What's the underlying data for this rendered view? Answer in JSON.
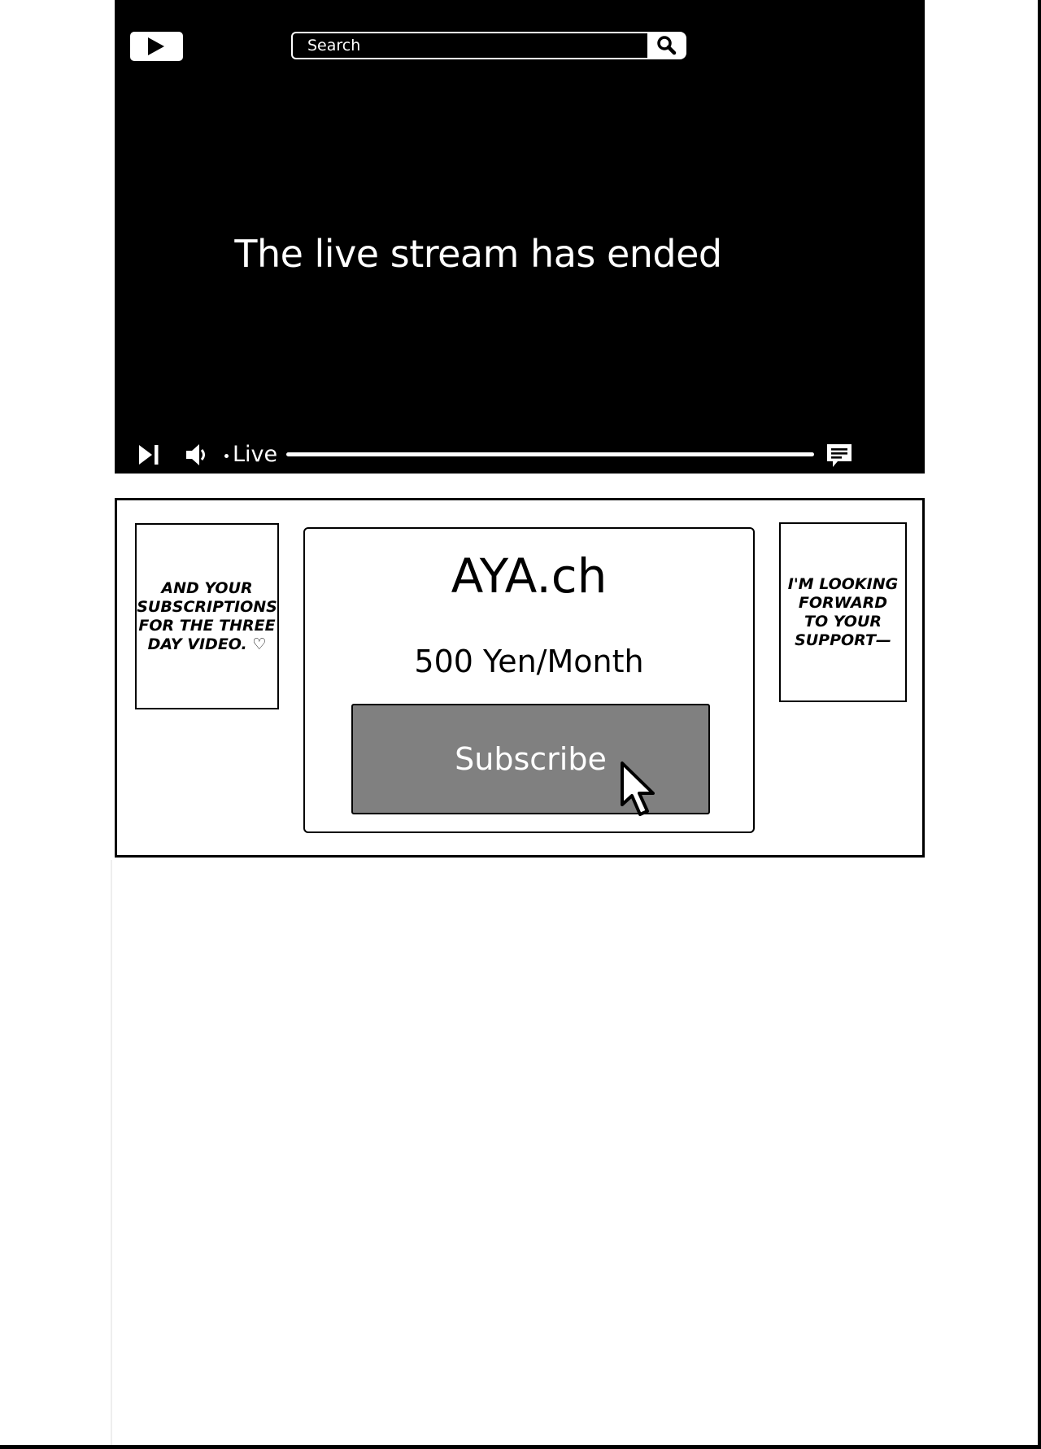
{
  "header": {
    "logo_icon": "play-logo-icon",
    "search_placeholder": "Search",
    "search_icon": "search-icon"
  },
  "player": {
    "message": "The live stream has ended",
    "controls": {
      "play_icon": "play-next-icon",
      "volume_icon": "volume-icon",
      "live_label": "Live",
      "chat_icon": "chat-icon"
    }
  },
  "panel": {
    "left_bubble": "AND YOUR SUBSCRIPTIONS FOR THE THREE DAY VIDEO. ♡",
    "right_bubble": "I'M LOOKING FORWARD TO YOUR SUPPORT—",
    "channel_name": "AYA.ch",
    "price": "500 Yen/Month",
    "subscribe_label": "Subscribe",
    "cursor_icon": "mouse-pointer-icon"
  },
  "colors": {
    "player_bg": "#000000",
    "button_bg": "#808080",
    "text_light": "#ffffff"
  }
}
